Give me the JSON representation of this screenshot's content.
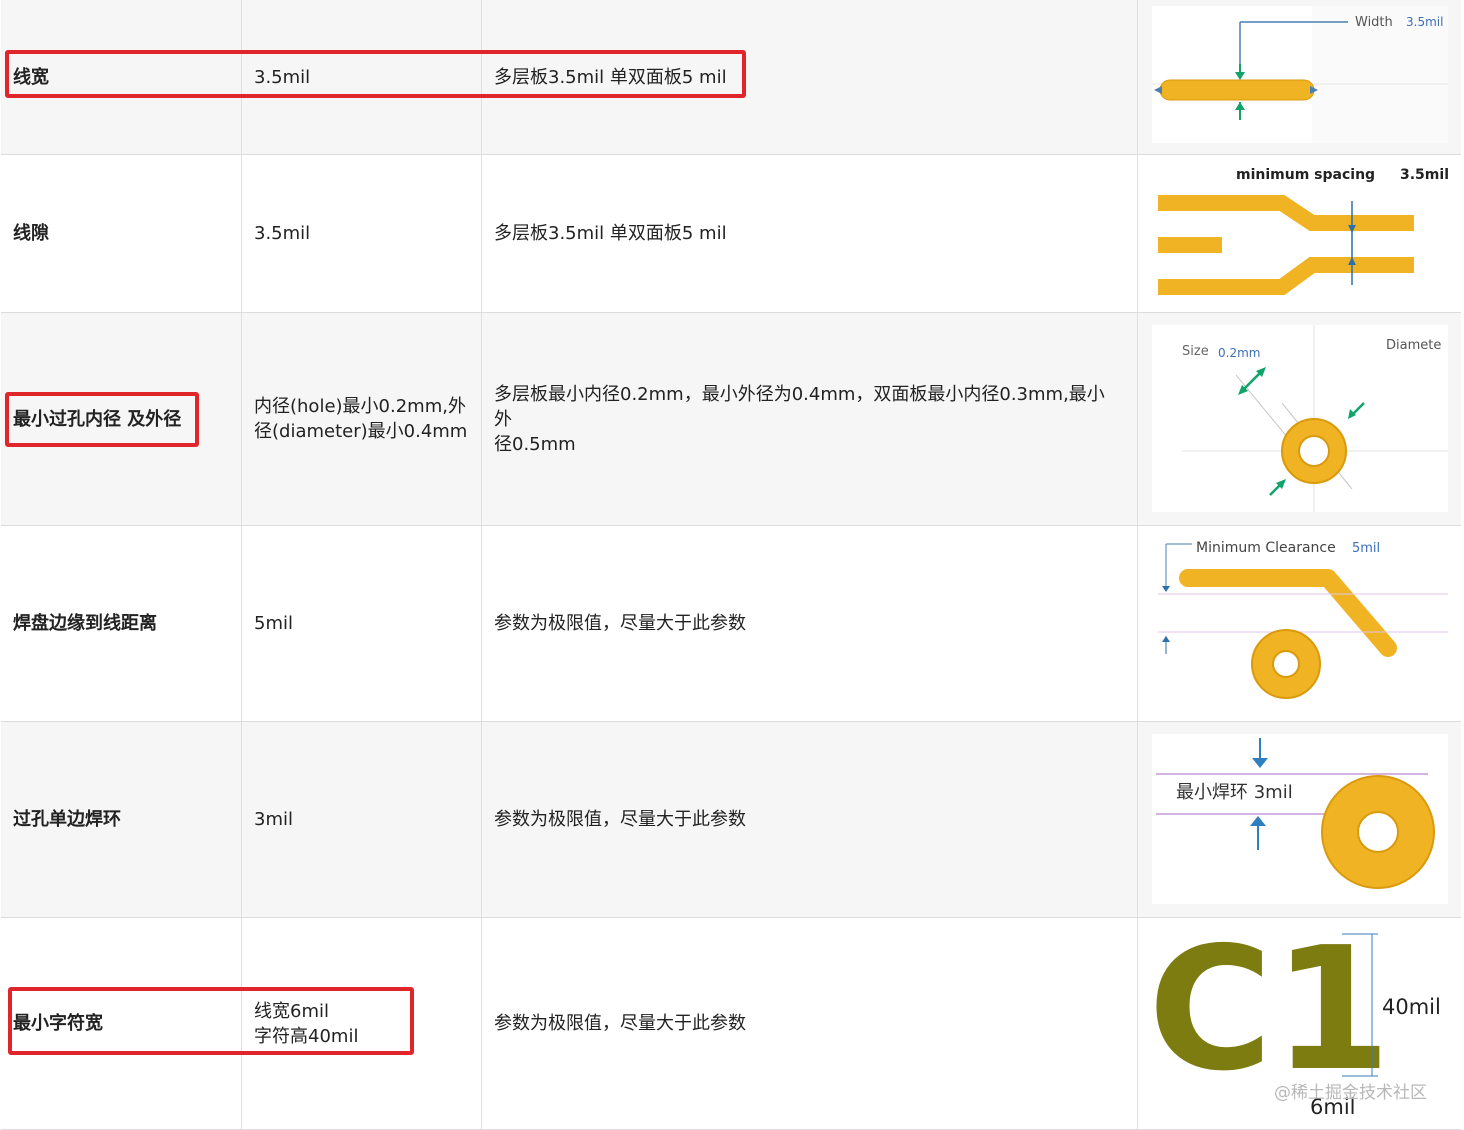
{
  "rows": [
    {
      "name": "线宽",
      "value": "3.5mil",
      "note": "多层板3.5mil 单双面板5 mil",
      "figure": {
        "label": "Width",
        "value": "3.5mil"
      }
    },
    {
      "name": "线隙",
      "value": "3.5mil",
      "note": "多层板3.5mil 单双面板5 mil",
      "figure": {
        "label": "minimum spacing",
        "value": "3.5mil"
      }
    },
    {
      "name": "最小过孔内径 及外径",
      "value_lines": [
        "内径(hole)最小0.2mm,外",
        "径(diameter)最小0.4mm"
      ],
      "note_lines": [
        "多层板最小内径0.2mm，最小外径为0.4mm，双面板最小内径0.3mm,最小外",
        "径0.5mm"
      ],
      "figure": {
        "label": "Size",
        "value": "0.2mm",
        "label2": "Diamete"
      }
    },
    {
      "name": "焊盘边缘到线距离",
      "value": "5mil",
      "note": "参数为极限值，尽量大于此参数",
      "figure": {
        "label": "Minimum Clearance",
        "value": "5mil"
      }
    },
    {
      "name": "过孔单边焊环",
      "value": "3mil",
      "note": "参数为极限值，尽量大于此参数",
      "figure": {
        "label": "最小焊环 3mil"
      }
    },
    {
      "name": "最小字符宽",
      "value_lines": [
        "线宽6mil",
        "字符高40mil"
      ],
      "note": "参数为极限值，尽量大于此参数",
      "figure": {
        "glyphs": "C1",
        "height": "40mil",
        "width": "6mil"
      }
    }
  ],
  "watermark": "@稀土掘金技术社区",
  "colors": {
    "highlight": "#e0262a",
    "copper": "#f0b323",
    "silk": "#7c7c10"
  }
}
